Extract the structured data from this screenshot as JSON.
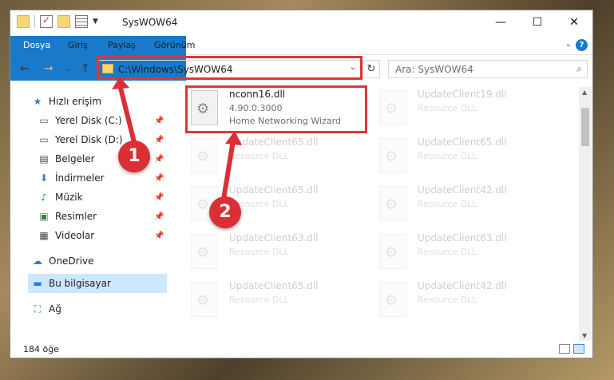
{
  "window": {
    "title": "SysWOW64",
    "controls": {
      "minimize": "—",
      "maximize": "☐",
      "close": "✕"
    }
  },
  "ribbon": {
    "tabs": [
      "Dosya",
      "Giriş",
      "Paylaş",
      "Görünüm"
    ],
    "expand_icon": "chevron-down-icon",
    "help_label": "?"
  },
  "address": {
    "path": "C:\\Windows\\SysWOW64",
    "search_placeholder": "Ara: SysWOW64"
  },
  "nav": {
    "items": [
      {
        "label": "Hızlı erişim",
        "icon": "star-icon",
        "pinned": false
      },
      {
        "label": "Yerel Disk (C:)",
        "icon": "drive-icon",
        "pinned": true
      },
      {
        "label": "Yerel Disk (D:)",
        "icon": "drive-icon",
        "pinned": true
      },
      {
        "label": "Belgeler",
        "icon": "documents-icon",
        "pinned": true
      },
      {
        "label": "İndirmeler",
        "icon": "download-icon",
        "pinned": true
      },
      {
        "label": "Müzik",
        "icon": "music-icon",
        "pinned": true
      },
      {
        "label": "Resimler",
        "icon": "pictures-icon",
        "pinned": true
      },
      {
        "label": "Videolar",
        "icon": "videos-icon",
        "pinned": true
      },
      {
        "label": "OneDrive",
        "icon": "cloud-icon",
        "pinned": false
      },
      {
        "label": "Bu bilgisayar",
        "icon": "computer-icon",
        "pinned": false,
        "selected": true
      },
      {
        "label": "Ağ",
        "icon": "network-icon",
        "pinned": false
      }
    ]
  },
  "files": [
    {
      "name": "nconn16.dll",
      "version": "4.90.0.3000",
      "description": "Home Networking Wizard",
      "highlighted": true
    },
    {
      "name": "UpdateClient19.dll",
      "version": "",
      "description": "Resource DLL"
    },
    {
      "name": "UpdateClient65.dll",
      "version": "",
      "description": "Resource DLL"
    },
    {
      "name": "UpdateClient65.dll",
      "version": "",
      "description": "Resource DLL"
    },
    {
      "name": "UpdateClient65.dll",
      "version": "",
      "description": "Resource DLL"
    },
    {
      "name": "UpdateClient42.dll",
      "version": "",
      "description": "Resource DLL"
    },
    {
      "name": "UpdateClient63.dll",
      "version": "",
      "description": "Resource DLL"
    },
    {
      "name": "UpdateClient63.dll",
      "version": "",
      "description": "Resource DLL"
    },
    {
      "name": "UpdateClient65.dll",
      "version": "",
      "description": "Resource DLL"
    },
    {
      "name": "UpdateClient42.dll",
      "version": "",
      "description": "Resource DLL"
    }
  ],
  "status": {
    "item_count": "184 öğe"
  },
  "callouts": [
    "1",
    "2"
  ],
  "colors": {
    "accent": "#1979ca",
    "highlight": "#e3343a",
    "callout": "#d92f35",
    "selection": "#cce8ff"
  }
}
